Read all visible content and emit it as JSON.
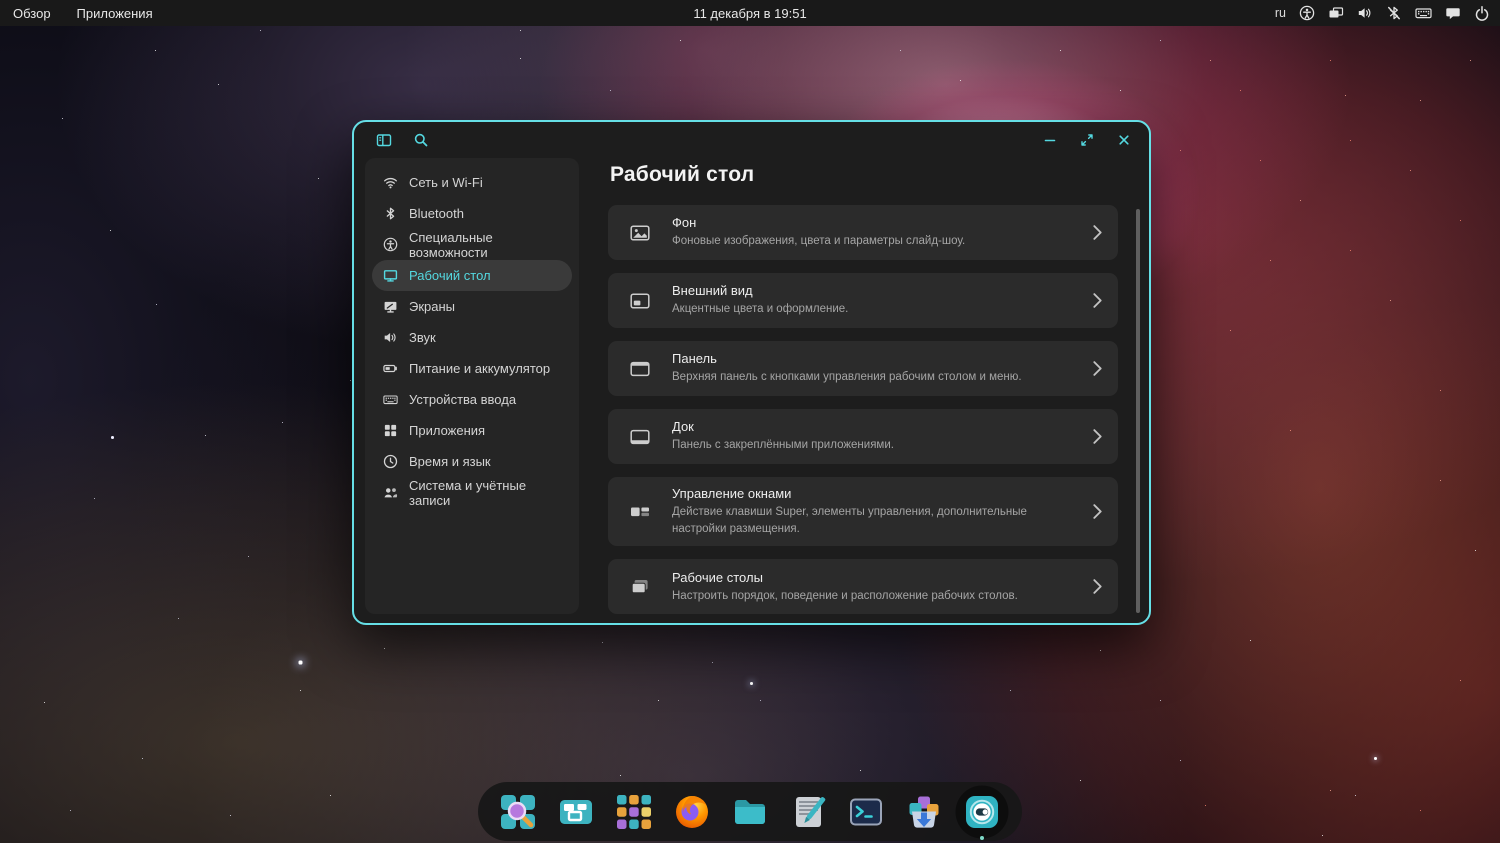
{
  "topbar": {
    "menus": [
      {
        "label": "Обзор"
      },
      {
        "label": "Приложения"
      }
    ],
    "clock": "11 декабря в 19:51",
    "keyboard_layout": "ru",
    "tray_icons": [
      "accessibility",
      "window-switcher",
      "volume",
      "bluetooth-disabled",
      "keyboard",
      "chat",
      "power"
    ]
  },
  "settings_window": {
    "accent_color": "#54d8e0",
    "border_color": "#66dfe6",
    "header": {
      "left_icons": [
        "sidebar-toggle",
        "search"
      ],
      "controls": [
        "minimize",
        "maximize",
        "close"
      ]
    },
    "sidebar": {
      "items": [
        {
          "label": "Сеть и Wi-Fi",
          "icon": "wifi",
          "selected": false
        },
        {
          "label": "Bluetooth",
          "icon": "bluetooth",
          "selected": false
        },
        {
          "label": "Специальные возможности",
          "icon": "accessibility",
          "selected": false
        },
        {
          "label": "Рабочий стол",
          "icon": "desktop-monitor",
          "selected": true
        },
        {
          "label": "Экраны",
          "icon": "displays",
          "selected": false
        },
        {
          "label": "Звук",
          "icon": "speaker",
          "selected": false
        },
        {
          "label": "Питание и аккумулятор",
          "icon": "battery",
          "selected": false
        },
        {
          "label": "Устройства ввода",
          "icon": "keyboard",
          "selected": false
        },
        {
          "label": "Приложения",
          "icon": "app-grid",
          "selected": false
        },
        {
          "label": "Время и язык",
          "icon": "clock",
          "selected": false
        },
        {
          "label": "Система и учётные записи",
          "icon": "users",
          "selected": false
        }
      ]
    },
    "page": {
      "title": "Рабочий стол",
      "rows": [
        {
          "title": "Фон",
          "description": "Фоновые изображения, цвета и параметры слайд-шоу.",
          "icon": "background-image"
        },
        {
          "title": "Внешний вид",
          "description": "Акцентные цвета и оформление.",
          "icon": "appearance"
        },
        {
          "title": "Панель",
          "description": "Верхняя панель с кнопками управления рабочим столом и меню.",
          "icon": "top-panel"
        },
        {
          "title": "Док",
          "description": "Панель с закреплёнными приложениями.",
          "icon": "dock-panel"
        },
        {
          "title": "Управление окнами",
          "description": "Действие клавиши Super, элементы управления, дополнительные настройки размещения.",
          "icon": "window-management"
        },
        {
          "title": "Рабочие столы",
          "description": "Настроить порядок, поведение и расположение рабочих столов.",
          "icon": "workspaces"
        }
      ]
    }
  },
  "dock": {
    "items": [
      {
        "name": "overview",
        "active": false
      },
      {
        "name": "workspaces",
        "active": false
      },
      {
        "name": "app-grid",
        "active": false
      },
      {
        "name": "firefox",
        "active": false
      },
      {
        "name": "files",
        "active": false
      },
      {
        "name": "text-editor",
        "active": false
      },
      {
        "name": "terminal",
        "active": false
      },
      {
        "name": "software-installer",
        "active": false
      },
      {
        "name": "settings",
        "active": true
      }
    ]
  }
}
